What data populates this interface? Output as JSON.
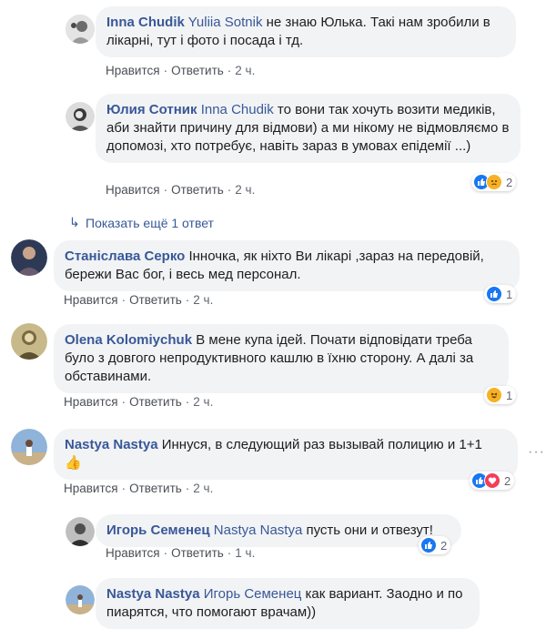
{
  "comments": [
    {
      "author": "Inna Chudik",
      "mention": "Yuliia Sotnik",
      "text": " не знаю Юлька. Такі нам зробили в лікарні, тут і фото і посада і тд.",
      "actions": {
        "like": "Нравится",
        "reply": "Ответить",
        "time": "2 ч."
      }
    },
    {
      "author": "Юлия Сотник",
      "mention": "Inna Chudik",
      "text": " то вони так хочуть возити медиків, аби знайти причину для відмови) а ми нікому не відмовляємо в допомозі, хто потребує, навіть зараз в умовах епідемії ...)",
      "actions": {
        "like": "Нравится",
        "reply": "Ответить",
        "time": "2 ч."
      },
      "reactions": {
        "icons": [
          "like-icon",
          "sad-icon"
        ],
        "count": "2"
      }
    },
    {
      "author": "Станіслава Серко",
      "mention": "",
      "text": " Інночка, як ніхто Ви лікарі ,зараз на передовій, бережи Вас бог, і весь мед персонал.",
      "actions": {
        "like": "Нравится",
        "reply": "Ответить",
        "time": "2 ч."
      },
      "reactions": {
        "icons": [
          "like-icon"
        ],
        "count": "1"
      }
    },
    {
      "author": "Olena Kolomiychuk",
      "mention": "",
      "text": " В мене купа ідей. Почати відповідати треба було з довгого непродуктивного кашлю в їхню сторону. А далі за обставинами.",
      "actions": {
        "like": "Нравится",
        "reply": "Ответить",
        "time": "2 ч."
      },
      "reactions": {
        "icons": [
          "haha-icon"
        ],
        "count": "1"
      }
    },
    {
      "author": "Nastya Nastya",
      "mention": "",
      "text": " Иннуся, в следующий раз вызывай полицию и 1+1",
      "emoji": "👍",
      "actions": {
        "like": "Нравится",
        "reply": "Ответить",
        "time": "2 ч."
      },
      "reactions": {
        "icons": [
          "like-icon",
          "love-icon"
        ],
        "count": "2"
      }
    },
    {
      "author": "Игорь Семенец",
      "mention": "Nastya Nastya",
      "text": " пусть они и отвезут!",
      "actions": {
        "like": "Нравится",
        "reply": "Ответить",
        "time": "1 ч."
      },
      "reactions": {
        "icons": [
          "like-icon"
        ],
        "count": "2"
      }
    },
    {
      "author": "Nastya Nastya",
      "mention": "Игорь Семенец",
      "text": " как вариант. Заодно и по пиарятся, что помогают врачам))",
      "actions": {}
    }
  ],
  "show_more": {
    "label": "Показать ещё 1 ответ",
    "icon": "reply-arrow-icon"
  },
  "colors": {
    "link": "#385898",
    "bubble": "#f2f3f5",
    "like": "#1877f2",
    "haha": "#f7b125",
    "love": "#f33e58"
  }
}
